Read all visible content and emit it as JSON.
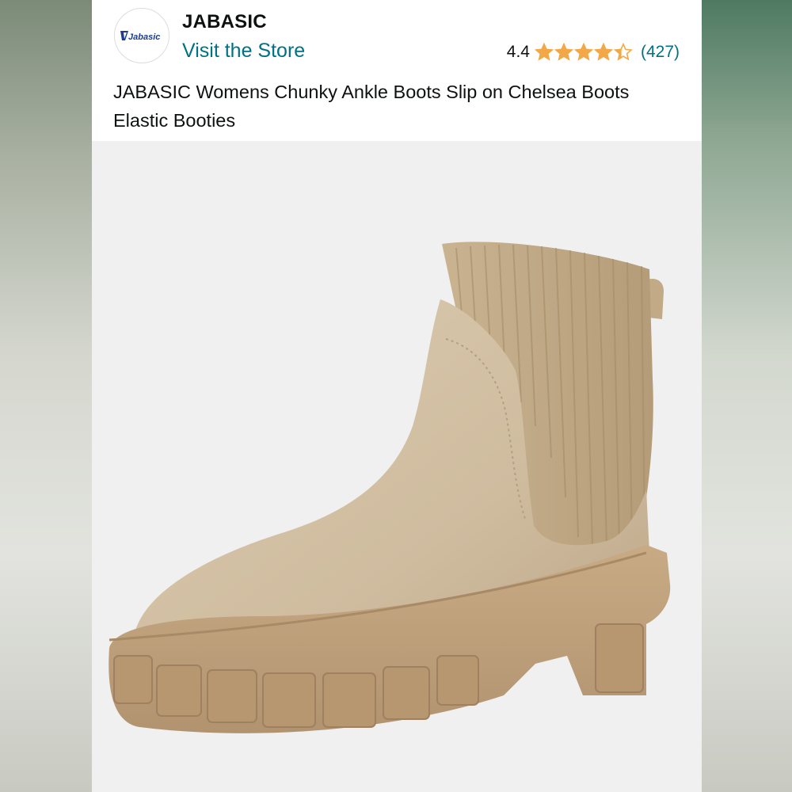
{
  "store": {
    "brand_name": "JABASIC",
    "logo_text": "Jabasic",
    "visit_store_label": "Visit the Store"
  },
  "rating": {
    "value_text": "4.4",
    "value": 4.4,
    "max": 5,
    "count_text": "(427)"
  },
  "product": {
    "title": "JABASIC Womens Chunky Ankle Boots Slip on Chelsea Boots Elastic Booties",
    "image_subject": "beige suede chelsea ankle boot with ribbed knit collar and chunky lug sole"
  },
  "colors": {
    "link": "#007185",
    "star": "#f3a847",
    "text": "#0f1111",
    "boot_suede": "#d2c0a4",
    "boot_sole": "#c2a47e",
    "image_bg": "#f0f0f0"
  },
  "icons": {
    "star": "star-icon",
    "logo": "jabasic-logo-icon"
  }
}
